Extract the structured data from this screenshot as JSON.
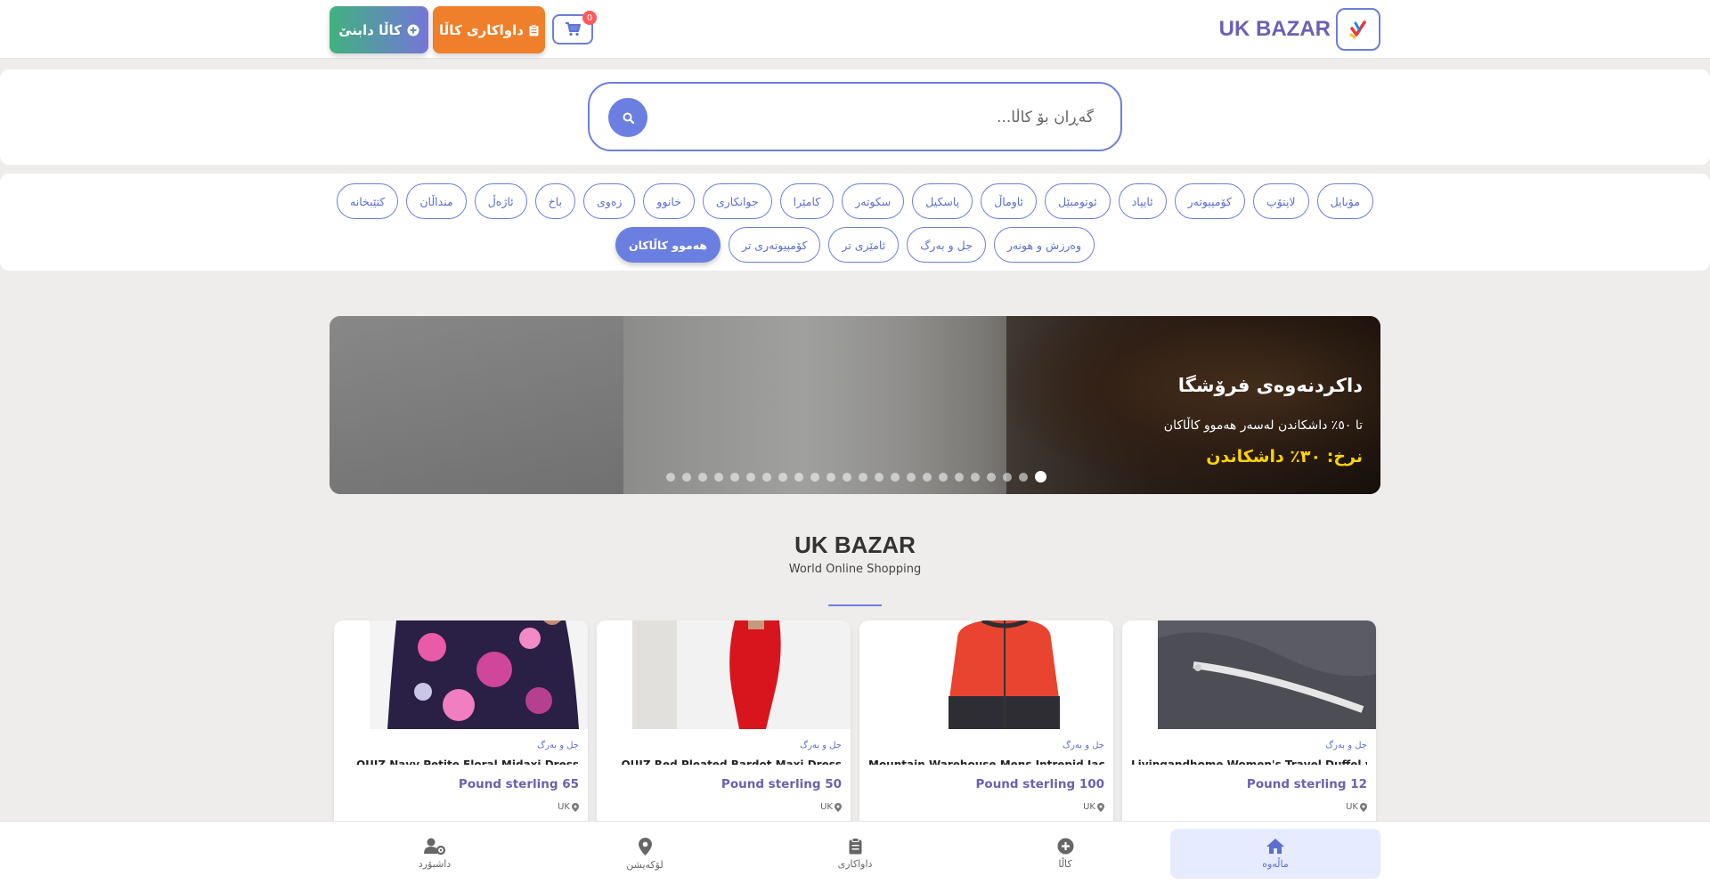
{
  "header": {
    "brand": "UK BAZAR",
    "cart_count": "0",
    "orders_label": "داواکاری کاڵا",
    "add_label": "کاڵا دابنێ"
  },
  "search": {
    "placeholder": "گەڕان بۆ کاڵا..."
  },
  "categories": {
    "row1": [
      "مۆبایل",
      "لاپتۆپ",
      "کۆمپیوتەر",
      "ئایپاد",
      "ئوتومبێل",
      "ئاوماڵ",
      "پاسکیل",
      "سکوتەر",
      "کامێرا",
      "جوانکاری",
      "خانوو",
      "زەوی",
      "باخ",
      "ئاژەڵ",
      "منداڵان",
      "کتێبخانە"
    ],
    "row2": [
      "وەرزش و هونەر",
      "جل و بەرگ",
      "ئامێری تر",
      "کۆمپیوتەری تر",
      "هەموو کاڵاکان"
    ],
    "active": "هەموو کاڵاکان"
  },
  "hero": {
    "title": "داکردنەوەی فرۆشگا",
    "subtitle": "تا ٥٠٪ داشکاندن لەسەر هەموو کاڵاکان",
    "rate": "نرخ: ٣٠٪ داشکاندن",
    "slide_count": 24,
    "active_slide": 23
  },
  "section": {
    "title": "UK BAZAR",
    "subtitle": "World Online Shopping"
  },
  "products": [
    {
      "category": "جل و بەرگ",
      "name": "Livingandhome Women's Travel Duffel with",
      "price": "Pound sterling 12",
      "location": "UK"
    },
    {
      "category": "جل و بەرگ",
      "name": "Mountain Warehouse Mens Intrepid Jacket II",
      "price": "Pound sterling 100",
      "location": "UK"
    },
    {
      "category": "جل و بەرگ",
      "name": "QUIZ Red Pleated Bardot Maxi Dress",
      "price": "Pound sterling 50",
      "location": "UK"
    },
    {
      "category": "جل و بەرگ",
      "name": "QUIZ Navy Petite Floral Midaxi Dress",
      "price": "Pound sterling 65",
      "location": "UK"
    }
  ],
  "nav": {
    "home": "ماڵەوە",
    "product": "کاڵا",
    "orders": "داواکاری",
    "location": "لۆکەیشن",
    "dashboard": "داشبۆرد"
  },
  "colors": {
    "accent": "#6b7fe0",
    "brand": "#6d5fb2",
    "orders_button": "#ef7f2a",
    "hero_rate": "#ffd400",
    "badge": "#ff5a5a"
  },
  "icons": [
    "home-icon",
    "plus-circle-icon",
    "clipboard-icon",
    "map-pin-icon",
    "user-gear-icon",
    "cart-icon",
    "search-icon"
  ]
}
